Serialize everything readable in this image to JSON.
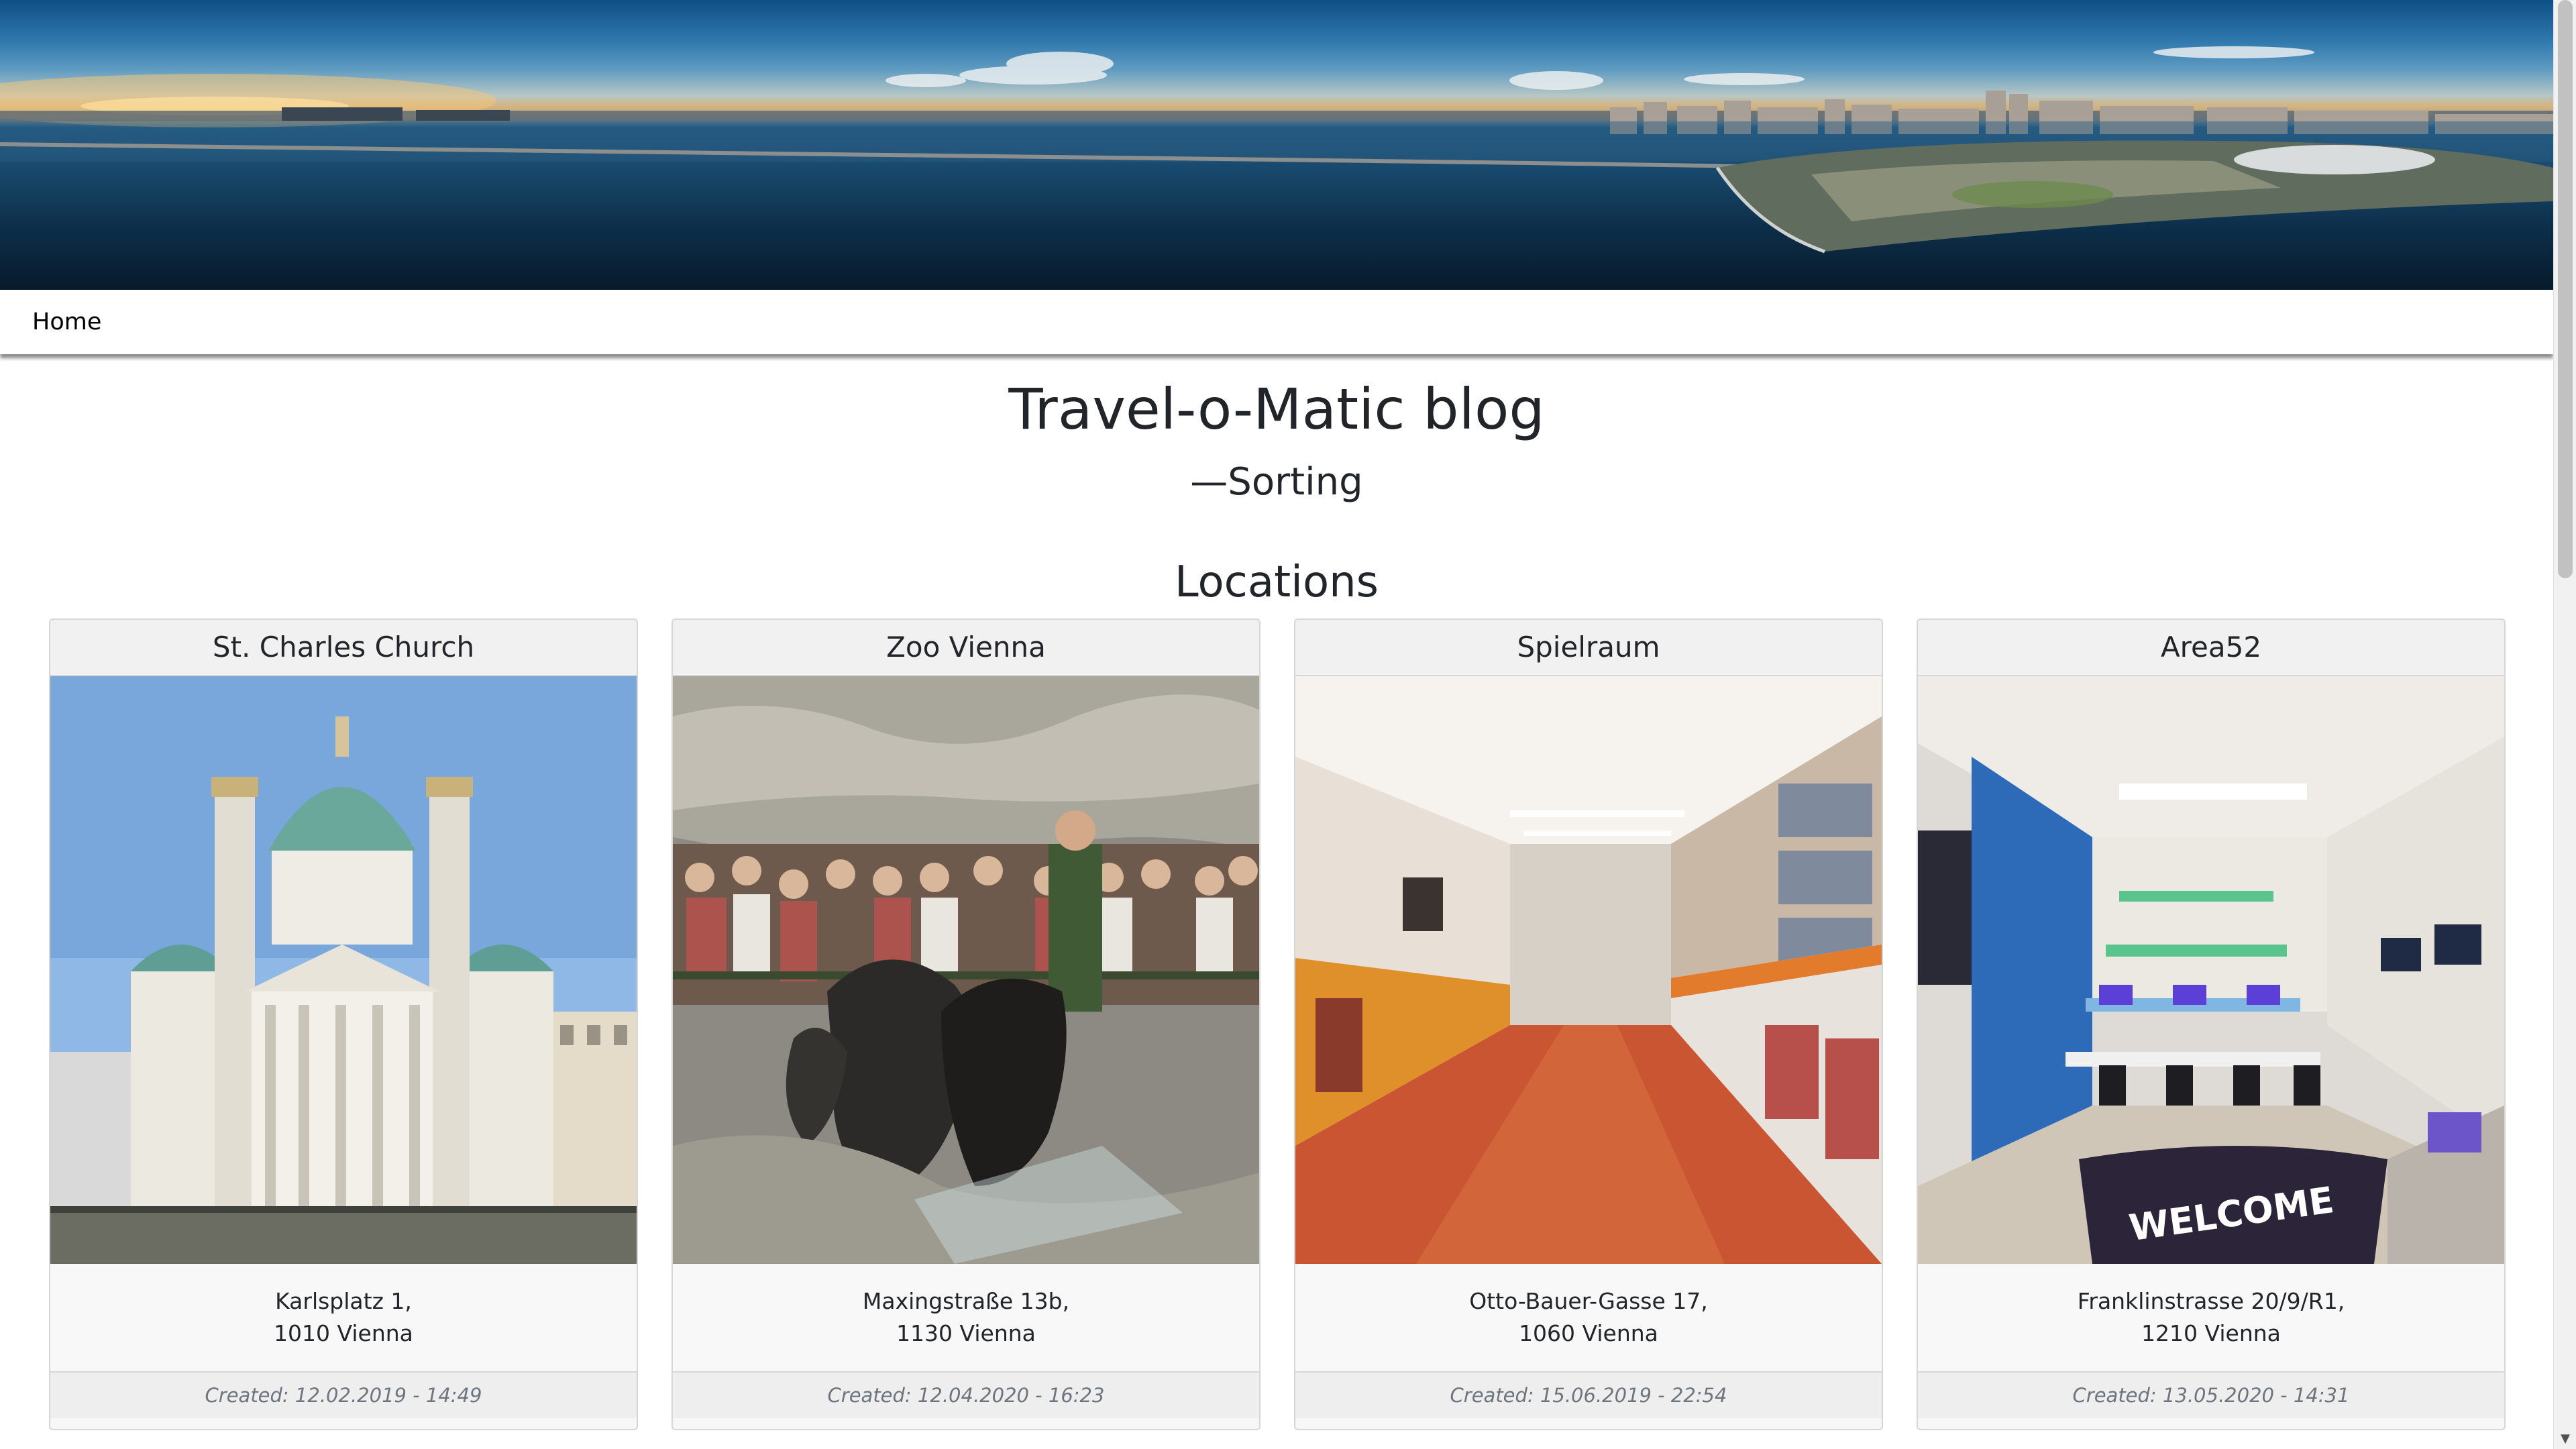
{
  "nav": {
    "home": "Home"
  },
  "header": {
    "title": "Travel-o-Matic blog",
    "subtitle": "—Sorting",
    "section": "Locations"
  },
  "locations": [
    {
      "name": "St. Charles Church",
      "address_line1": "Karlsplatz 1,",
      "address_line2": "1010 Vienna",
      "created": "Created: 12.02.2019 - 14:49"
    },
    {
      "name": "Zoo Vienna",
      "address_line1": "Maxingstraße 13b,",
      "address_line2": "1130 Vienna",
      "created": "Created: 12.04.2020 - 16:23"
    },
    {
      "name": "Spielraum",
      "address_line1": "Otto-Bauer-Gasse 17,",
      "address_line2": "1060 Vienna",
      "created": "Created: 15.06.2019 - 22:54"
    },
    {
      "name": "Area52",
      "address_line1": "Franklinstrasse 20/9/R1,",
      "address_line2": "1210 Vienna",
      "created": "Created: 13.05.2020 - 14:31"
    }
  ],
  "images": {
    "church": "photo-church-baroque",
    "zoo": "photo-sea-lions",
    "spielraum": "photo-game-shop",
    "area52": "photo-gaming-lounge"
  },
  "area52_sign": "WELCOME",
  "colors": {
    "navbar_bg": "#ffffff",
    "card_bg": "#f7f7f7",
    "card_border": "#d6d6d6",
    "footer_text": "#6c757d"
  }
}
